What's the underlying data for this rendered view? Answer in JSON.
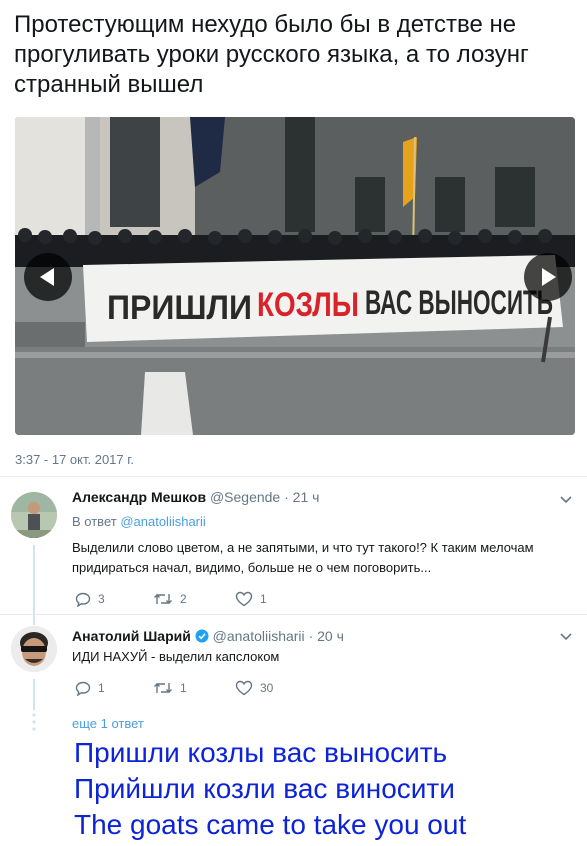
{
  "tweet": {
    "text": "Протестующим нехудо было бы в детстве не прогуливать уроки русского языка, а то лозунг странный вышел",
    "timestamp": "3:37 - 17 окт. 2017 г.",
    "photo": {
      "banner_part1": "ПРИШЛИ",
      "banner_part2": "КОЗЛЫ",
      "banner_part3": "ВАС ВЫНОСИТЬ"
    }
  },
  "replies": [
    {
      "name": "Александр Мешков",
      "handle": "@Segende",
      "time": "· 21 ч",
      "in_reply_label": "В ответ",
      "in_reply_handle": "@anatoliisharii",
      "text": "Выделили слово цветом, а не запятыми, и что тут такого!? К таким мелочам придираться начал, видимо, больше не о чем поговорить...",
      "reply_count": "3",
      "retweet_count": "2",
      "like_count": "1"
    },
    {
      "name": "Анатолий Шарий",
      "handle": "@anatoliisharii",
      "time": "· 20 ч",
      "text": "ИДИ НАХУЙ - выделил капслоком",
      "reply_count": "1",
      "retweet_count": "1",
      "like_count": "30"
    }
  ],
  "more_replies": "еще 1 ответ",
  "captions": [
    "Пришли козлы вас выносить",
    "Прийшли козли вас виносити",
    "The goats came to take you out"
  ],
  "colors": {
    "link": "#4a9fe0",
    "caption": "#0d24d6",
    "verified": "#1da1f2",
    "banner_red": "#d8232a",
    "banner_text": "#2a2a2a"
  }
}
